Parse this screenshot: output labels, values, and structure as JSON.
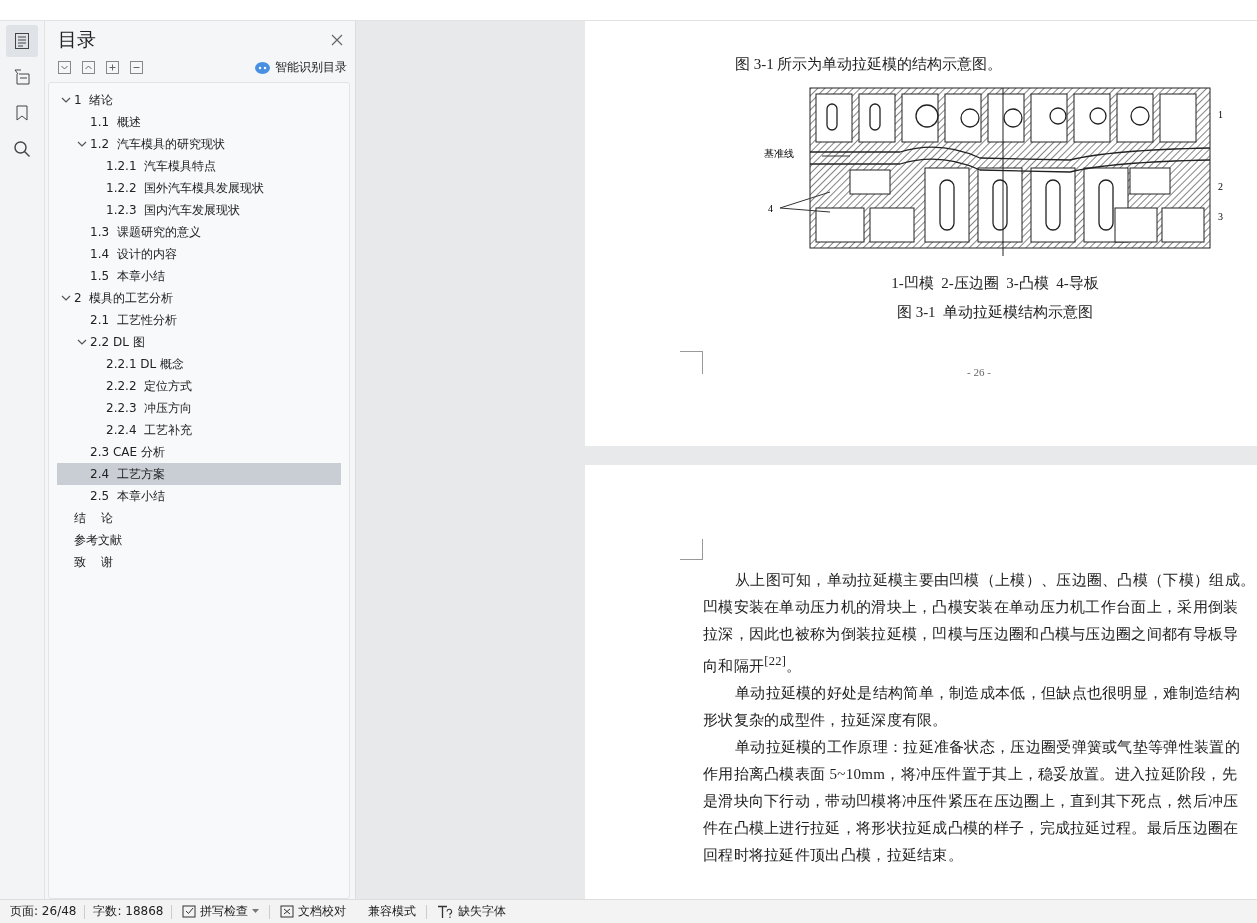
{
  "rail": [
    {
      "selected": true
    },
    {
      "selected": false
    },
    {
      "selected": false
    },
    {
      "selected": false
    }
  ],
  "toc": {
    "title": "目录",
    "smart_button": "智能识别目录",
    "items": [
      {
        "label": "1  绪论",
        "selected": false,
        "expanded": true,
        "children": [
          {
            "label": "1.1  概述",
            "selected": false
          },
          {
            "label": "1.2  汽车模具的研究现状",
            "selected": false,
            "expanded": true,
            "children": [
              {
                "label": "1.2.1  汽车模具特点",
                "selected": false
              },
              {
                "label": "1.2.2  国外汽车模具发展现状",
                "selected": false
              },
              {
                "label": "1.2.3  国内汽车发展现状",
                "selected": false
              }
            ]
          },
          {
            "label": "1.3  课题研究的意义",
            "selected": false
          },
          {
            "label": "1.4  设计的内容",
            "selected": false
          },
          {
            "label": "1.5  本章小结",
            "selected": false
          }
        ]
      },
      {
        "label": "2  模具的工艺分析",
        "selected": false,
        "expanded": true,
        "children": [
          {
            "label": "2.1  工艺性分析",
            "selected": false
          },
          {
            "label": "2.2 DL 图",
            "selected": false,
            "expanded": true,
            "children": [
              {
                "label": "2.2.1 DL 概念",
                "selected": false
              },
              {
                "label": "2.2.2  定位方式",
                "selected": false
              },
              {
                "label": "2.2.3  冲压方向",
                "selected": false
              },
              {
                "label": "2.2.4  工艺补充",
                "selected": false
              }
            ]
          },
          {
            "label": "2.3 CAE 分析",
            "selected": false
          },
          {
            "label": "2.4  工艺方案",
            "selected": true
          },
          {
            "label": "2.5  本章小结",
            "selected": false
          }
        ]
      },
      {
        "label": "结    论",
        "selected": false
      },
      {
        "label": "参考文献",
        "selected": false
      },
      {
        "label": "致    谢",
        "selected": false
      }
    ]
  },
  "page1": {
    "intro": "图 3-1 所示为单动拉延模的结构示意图。",
    "figure_labels": [
      {
        "text": "基准线"
      },
      {
        "text": "1"
      },
      {
        "text": "2"
      },
      {
        "text": "3"
      },
      {
        "text": "4"
      }
    ],
    "legend": "1-凹模  2-压边圈  3-凸模  4-导板",
    "caption": "图 3-1  单动拉延模结构示意图",
    "page_number": "- 26 -"
  },
  "page2": {
    "paragraphs": [
      {
        "lines": [
          "从上图可知，单动拉延模主要由凹模（上模）、压边圈、凸模（下模）组成。",
          "凹模安装在单动压力机的滑块上，凸模安装在单动压力机工作台面上，采用倒装",
          "拉深，因此也被称为倒装拉延模，凹模与压边圈和凸模与压边圈之间都有导板导",
          "向和隔开$^{[22]}$。"
        ]
      },
      {
        "lines": [
          "单动拉延模的好处是结构简单，制造成本低，但缺点也很明显，难制造结构",
          "形状复杂的成型件，拉延深度有限。"
        ]
      },
      {
        "lines": [
          "单动拉延模的工作原理：拉延准备状态，压边圈受弹簧或气垫等弹性装置的",
          "作用抬离凸模表面 5~10mm，将冲压件置于其上，稳妥放置。进入拉延阶段，先",
          "是滑块向下行动，带动凹模将冲压件紧压在压边圈上，直到其下死点，然后冲压",
          "件在凸模上进行拉延，将形状拉延成凸模的样子，完成拉延过程。最后压边圈在",
          "回程时将拉延件顶出凸模，拉延结束。"
        ]
      }
    ]
  },
  "status_bar": {
    "page": "页面: 26/48",
    "words": "字数: 18868",
    "spell_check": "拼写检查",
    "proofread": "文档校对",
    "compat": "兼容模式",
    "missing_font": "缺失字体"
  }
}
